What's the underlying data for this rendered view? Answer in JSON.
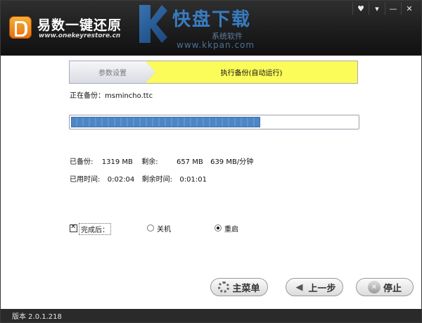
{
  "app": {
    "title": "易数一键还原",
    "url": "www.onekeyrestore.cn"
  },
  "watermark": {
    "text": "快盘下载",
    "sub": "系统软件",
    "url": "www.kkpan.com"
  },
  "window_controls": [
    "♥",
    "▾",
    "—",
    "✕"
  ],
  "steps": {
    "step1": "参数设置",
    "step2": "执行备份(自动运行)"
  },
  "status": {
    "backing_up_label": "正在备份：",
    "backing_up_file": "msmincho.ttc"
  },
  "progress": {
    "fraction": 0.66
  },
  "stats": {
    "backed_label": "已备份:",
    "backed_value": "1319 MB",
    "remaining_label": "剩余:",
    "remaining_value": "657 MB",
    "speed": "639 MB/分钟",
    "elapsed_label": "已用时间:",
    "elapsed_value": "0:02:04",
    "time_left_label": "剩余时间:",
    "time_left_value": "0:01:01"
  },
  "after_completion": {
    "label": "完成后：",
    "checked": true,
    "options": [
      "关机",
      "重启"
    ],
    "selected": "重启"
  },
  "buttons": {
    "main_menu": "主菜单",
    "prev": "上一步",
    "stop": "停止"
  },
  "footer": {
    "version": "版本 2.0.1.218"
  },
  "colors": {
    "active_step": "#fbfb5a",
    "progress": "#4d86c4",
    "titlebar": "#1b1b1b"
  }
}
